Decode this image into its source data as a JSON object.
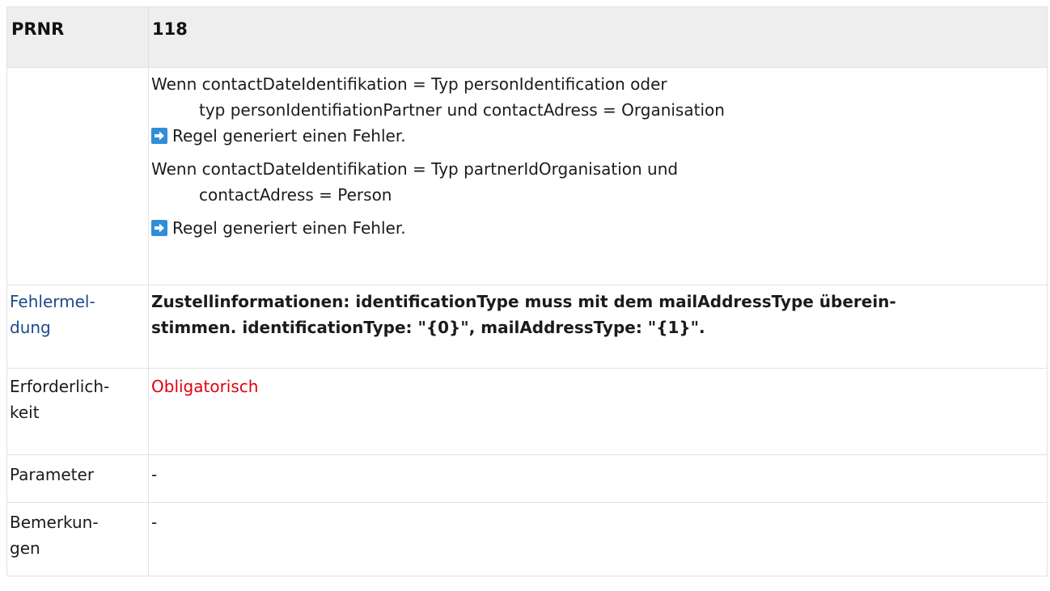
{
  "header": {
    "label": "PRNR",
    "value": "118"
  },
  "rules": {
    "block1_line1": "Wenn contactDateIdentifikation = Typ personIdentification oder",
    "block1_line2": "typ personIdentifiationPartner und contactAdress = Organisation",
    "block1_result": "Regel generiert einen Fehler.",
    "block2_line1": "Wenn contactDateIdentifikation = Typ partnerIdOrganisation und",
    "block2_line2": "contactAdress = Person",
    "block2_result": "Regel generiert einen Fehler.",
    "arrow_icon": "arrow-right-icon",
    "arrow_color": "#2f8fd6"
  },
  "error_message": {
    "label_line1": "Fehlermel-",
    "label_line2": "dung",
    "text_line1": "Zustellinformationen: identificationType muss mit dem mailAddressType überein-",
    "text_line2": "stimmen. identificationType: \"{0}\", mailAddressType: \"{1}\"."
  },
  "requirement": {
    "label_line1": "Erforderlich-",
    "label_line2": "keit",
    "value": "Obligatorisch",
    "value_color": "#e0000f"
  },
  "parameter": {
    "label": "Parameter",
    "value": "-"
  },
  "remarks": {
    "label_line1": "Bemerkun-",
    "label_line2": "gen",
    "value": "-"
  }
}
